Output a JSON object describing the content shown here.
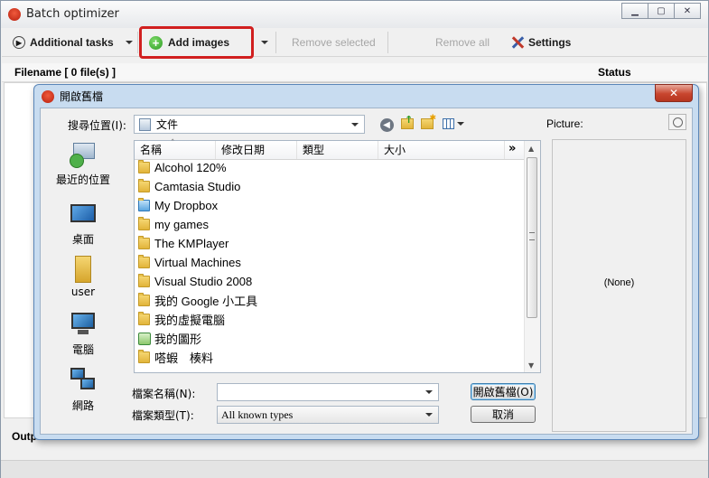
{
  "main_window": {
    "title": "Batch optimizer",
    "caption_buttons": [
      "minimize",
      "maximize",
      "close"
    ]
  },
  "toolbar": {
    "additional_tasks": "Additional tasks",
    "add_images": "Add images",
    "remove_selected": "Remove selected",
    "remove_all": "Remove all",
    "settings": "Settings"
  },
  "file_list": {
    "filename_header": "Filename  [ 0 file(s) ]",
    "status_header": "Status"
  },
  "bottom": {
    "output_label_partial": "Outp"
  },
  "dialog": {
    "title": "開啟舊檔",
    "look_in_label": "搜尋位置(I):",
    "look_in_value": "文件",
    "places": [
      "最近的位置",
      "桌面",
      "user",
      "電腦",
      "網路"
    ],
    "columns": [
      "名稱",
      "修改日期",
      "類型",
      "大小"
    ],
    "more_columns": "»",
    "files": [
      {
        "name": "Alcohol 120%",
        "icon": "folder-icon"
      },
      {
        "name": "Camtasia Studio",
        "icon": "folder-icon"
      },
      {
        "name": "My Dropbox",
        "icon": "dropbox-folder-icon"
      },
      {
        "name": "my games",
        "icon": "folder-icon"
      },
      {
        "name": "The KMPlayer",
        "icon": "folder-icon"
      },
      {
        "name": "Virtual Machines",
        "icon": "folder-icon"
      },
      {
        "name": "Visual Studio 2008",
        "icon": "folder-icon"
      },
      {
        "name": "我的 Google 小工具",
        "icon": "folder-icon"
      },
      {
        "name": "我的虛擬電腦",
        "icon": "folder-icon"
      },
      {
        "name": "我的圖形",
        "icon": "pictures-folder-icon"
      },
      {
        "name": "嗒蝦　楱料",
        "icon": "folder-icon"
      }
    ],
    "filename_label": "檔案名稱(N):",
    "filename_value": "",
    "filetype_label": "檔案類型(T):",
    "filetype_value": "All known types",
    "open_button": "開啟舊檔(O)",
    "cancel_button": "取消",
    "picture_label": "Picture:",
    "picture_value": "(None)"
  }
}
